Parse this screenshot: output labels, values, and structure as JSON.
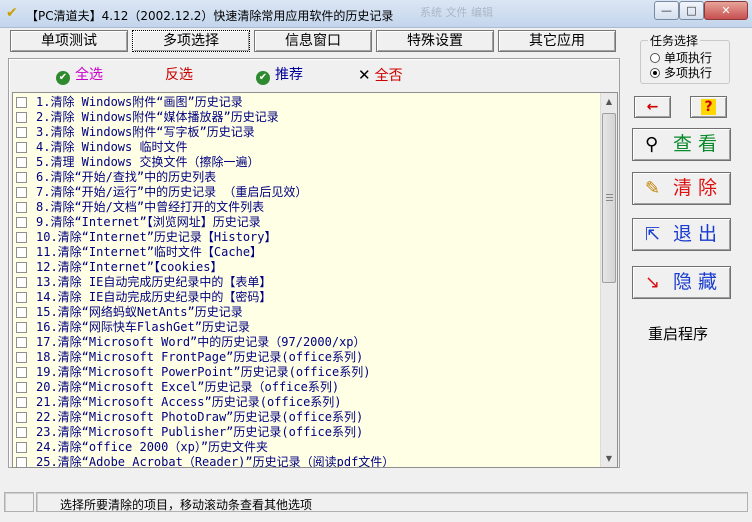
{
  "window": {
    "title": "【PC清道夫】4.12（2002.12.2）快速清除常用应用软件的历史记录",
    "bg_text": "系统 文件 编辑",
    "minimize": "—",
    "maximize": "□",
    "close": "✕"
  },
  "tabs": [
    {
      "label": "单项测试"
    },
    {
      "label": "多项选择"
    },
    {
      "label": "信息窗口"
    },
    {
      "label": "特殊设置"
    },
    {
      "label": "其它应用"
    }
  ],
  "toolbar": {
    "select_all": "全选",
    "invert": "反选",
    "recommend": "推荐",
    "select_none": "全否",
    "colors": {
      "select_all": "#cc00cc",
      "invert": "#cc0000",
      "recommend": "#000099",
      "select_none": "#cc0000"
    }
  },
  "list_items": [
    "1.清除 Windows附件“画图”历史记录",
    "2.清除 Windows附件“媒体播放器”历史记录",
    "3.清除 Windows附件“写字板”历史记录",
    "4.清除 Windows 临时文件",
    "5.清理 Windows 交换文件（擦除一遍）",
    "6.清除“开始/查找”中的历史列表",
    "7.清除“开始/运行”中的历史记录 （重启后见效）",
    "8.清除“开始/文档”中曾经打开的文件列表",
    "9.清除“Internet”【浏览网址】历史记录",
    "10.清除“Internet”历史记录【History】",
    "11.清除“Internet”临时文件【Cache】",
    "12.清除“Internet”【cookies】",
    "13.清除 IE自动完成历史纪录中的【表单】",
    "14.清除 IE自动完成历史纪录中的【密码】",
    "15.清除“网络蚂蚁NetAnts”历史记录",
    "16.清除“网际快车FlashGet”历史记录",
    "17.清除“Microsoft Word”中的历史记录（97/2000/xp）",
    "18.清除“Microsoft FrontPage”历史记录(office系列)",
    "19.清除“Microsoft PowerPoint”历史记录(office系列)",
    "20.清除“Microsoft Excel”历史记录（office系列)",
    "21.清除“Microsoft Access”历史记录(office系列)",
    "22.清除“Microsoft PhotoDraw”历史记录(office系列)",
    "23.清除“Microsoft Publisher”历史记录(office系列)",
    "24.清除“office 2000（xp）”历史文件夹",
    "25.清除“Adobe Acrobat（Reader)”历史记录（阅读pdf文件）"
  ],
  "task_group": {
    "title": "任务选择",
    "single": "单项执行",
    "multi": "多项执行",
    "selected": "multi"
  },
  "side": {
    "arrow_icon": "←",
    "help_icon": "?",
    "view": "查看",
    "clear": "清除",
    "exit": "退出",
    "hide": "隐藏",
    "restart": "重启程序"
  },
  "status": {
    "text": "选择所要清除的项目，移动滚动条查看其他选项"
  }
}
